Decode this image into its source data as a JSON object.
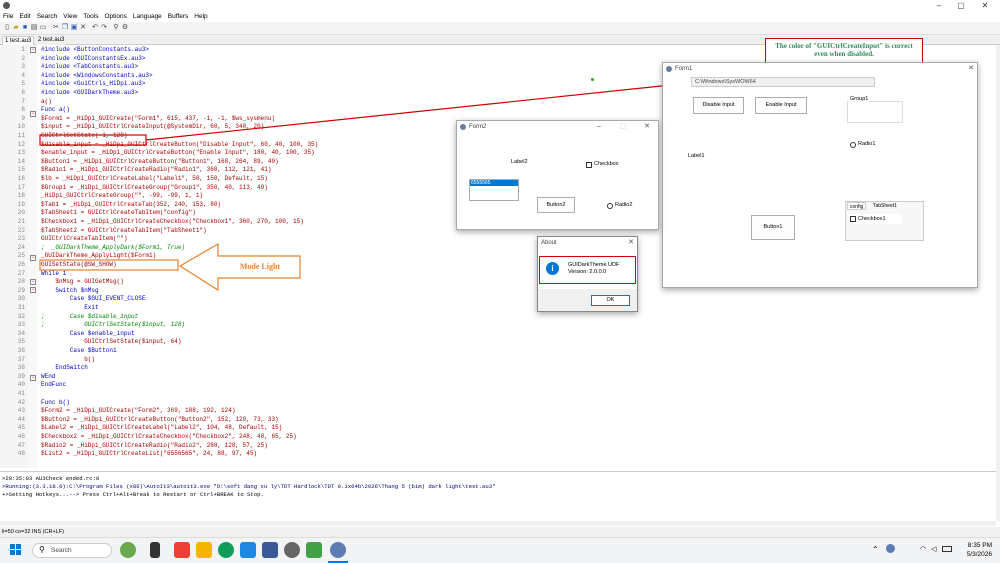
{
  "colors": {
    "accent": "#0078d4",
    "annot_border": "#d00000",
    "annot_text": "#2e8b57",
    "arrow": "#e4832d",
    "keyword": "#0000c8",
    "string": "#a00000",
    "comment": "#008000"
  },
  "window": {
    "controls": [
      "–",
      "▢",
      "✕"
    ]
  },
  "menu": [
    "File",
    "Edit",
    "Search",
    "View",
    "Tools",
    "Options",
    "Language",
    "Buffers",
    "Help"
  ],
  "tabs": [
    "1 test.au3",
    "2 test.au3"
  ],
  "code": {
    "line_numbers": [
      "1",
      "2",
      "3",
      "4",
      "5",
      "6",
      "7",
      "8",
      "9",
      "10",
      "11",
      "12",
      "13",
      "14",
      "15",
      "16",
      "17",
      "18",
      "19",
      "20",
      "21",
      "22",
      "23",
      "24",
      "25",
      "26",
      "27",
      "28",
      "29",
      "30",
      "31",
      "32",
      "33",
      "34",
      "35",
      "36",
      "37",
      "38",
      "39",
      "40",
      "41",
      "42",
      "43",
      "44",
      "45",
      "46",
      "47",
      "48"
    ],
    "lines": [
      "#include <ButtonConstants.au3>",
      "#include <GUIConstantsEx.au3>",
      "#include <TabConstants.au3>",
      "#include <WindowsConstants.au3>",
      "#include <GuiCtrls_HiDpi.au3>",
      "#include <GUIDarkTheme.au3>",
      "a()",
      "Func a()",
      "$Form1 = _HiDpi_GUICreate(\"Form1\", 615, 437, -1, -1, $ws_sysmenu)",
      "$input = _HiDpi_GUICtrlCreateInput(@SystemDir, 60, 5, 340, 20)",
      "GUICtrlSetState(-1, 128)",
      "$disable_input = _HiDpi_GUICtrlCreateButton(\"Disable Input\", 60, 40, 100, 35)",
      "$enable_input = _HiDpi_GUICtrlCreateButton(\"Enable Input\", 180, 40, 100, 35)",
      "$Button1 = _HiDpi_GUICtrlCreateButton(\"Button1\", 168, 264, 89, 49)",
      "$Radio1 = _HiDpi_GUICtrlCreateRadio(\"Radio1\", 360, 112, 121, 41)",
      "$lb = _HiDpi_GUICtrlCreateLabel(\"Label1\", 50, 150, Default, 15)",
      "$Group1 = _HiDpi_GUICtrlCreateGroup(\"Group1\", 350, 40, 113, 49)",
      "_HiDpi_GUICtrlCreateGroup(\"\", -99, -99, 1, 1)",
      "$Tab1 = _HiDpi_GUICtrlCreateTab(352, 240, 153, 80)",
      "$TabSheet1 = GUICtrlCreateTabItem(\"config\")",
      "$Checkbox1 = _HiDpi_GUICtrlCreateCheckbox(\"Checkbox1\", 360, 270, 100, 15)",
      "$TabSheet2 = GUICtrlCreateTabItem(\"TabSheet1\")",
      "GUICtrlCreateTabItem(\"\")",
      ";  _GUIDarkTheme_ApplyDark($Form1, True)",
      "_GUIDarkTheme_ApplyLight($Form1)",
      "GUISetState(@SW_SHOW)",
      "While 1",
      "    $nMsg = GUIGetMsg()",
      "    Switch $nMsg",
      "        Case $GUI_EVENT_CLOSE",
      "            Exit",
      ";       Case $disable_input",
      ";           GUICtrlSetState($input, 128)",
      "        Case $enable_input",
      "            GUICtrlSetState($input, 64)",
      "        Case $Button1",
      "            b()",
      "    EndSwitch",
      "WEnd",
      "EndFunc",
      "",
      "Func b()",
      "$Form2 = _HiDpi_GUICreate(\"Form2\", 369, 188, 192, 124)",
      "$Button2 = _HiDpi_GUICtrlCreateButton(\"Button2\", 152, 120, 73, 33)",
      "$Label2 = _HiDpi_GUICtrlCreateLabel(\"Label2\", 104, 48, Default, 15)",
      "$Checkbox2 = _HiDpi_GUICtrlCreateCheckbox(\"Checkbox2\", 248, 48, 65, 25)",
      "$Radio2 = _HiDpi_GUICtrlCreateRadio(\"Radio2\", 288, 128, 57, 25)",
      "$List2 = _HiDpi_GUICtrlCreateList(\"6556565\", 24, 88, 97, 45)"
    ]
  },
  "output": {
    "lines": [
      ">20:35:03 AU3Check ended.rc:0",
      ">Running:(3.3.18.0):C:\\Program Files (x86)\\AutoIt3\\autoit3.exe \"D:\\soft dang xu ly\\TDT Hardlock\\TDT 0.1x64b\\2026\\Thang 5 (bim) dark light\\test.au3\"",
      "+>Setting Hotkeys...--> Press Ctrl+Alt+Break to Restart or Ctrl+BREAK to Stop."
    ]
  },
  "status": "li=50 co=32 INS (CR+LF)",
  "annotation": {
    "input_note": "The color of \"GUICtrlCreateInput\" is correct even when disabled.",
    "mode_note": "Mode Light"
  },
  "form1": {
    "title": "Form1",
    "input_value": "C:\\Windows\\SysWOW64",
    "disable_btn": "Disable Input",
    "enable_btn": "Enable Input",
    "group": "Group1",
    "radio": "Radio1",
    "label": "Label1",
    "button": "Button1",
    "tabs": [
      "config",
      "TabSheet1"
    ],
    "checkbox": "Checkbox1"
  },
  "form2": {
    "title": "Form2",
    "label": "Label2",
    "checkbox": "Checkbox",
    "list_item": "6556565",
    "button": "Button2",
    "radio": "Radio2"
  },
  "about": {
    "title": "About",
    "line1": "GUIDarkTheme UDF",
    "line2": "Version:  2.0.0.0",
    "ok": "OK"
  },
  "taskbar": {
    "search_placeholder": "Search",
    "time": "8:35 PM",
    "date": "5/3/2026"
  }
}
